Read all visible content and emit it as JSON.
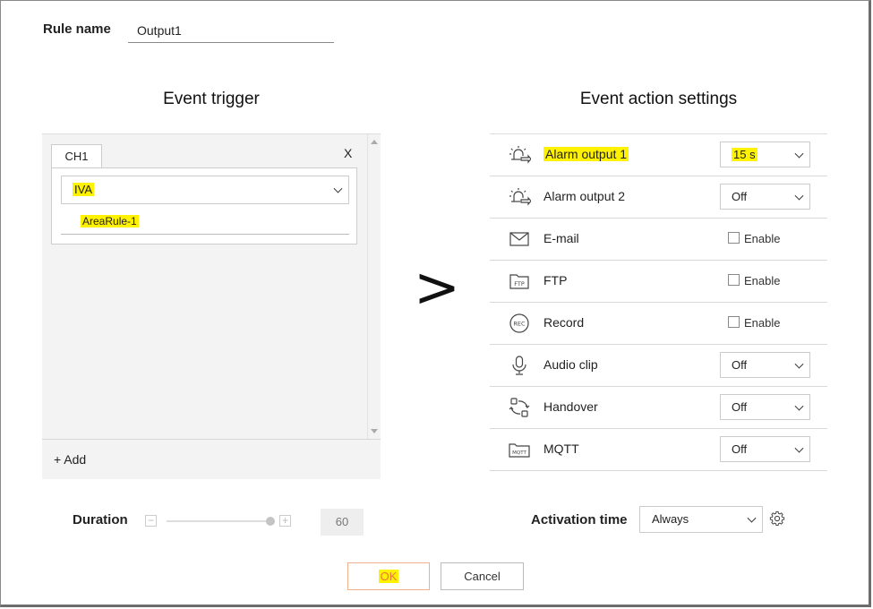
{
  "rule": {
    "label": "Rule name",
    "value": "Output1"
  },
  "event_trigger": {
    "title": "Event trigger",
    "tab_label": "CH1",
    "close_label": "X",
    "event_type": "IVA",
    "rule_item": "AreaRule-1",
    "add_label": "+ Add"
  },
  "separator": ">",
  "event_action": {
    "title": "Event action settings",
    "enable_label": "Enable",
    "actions": [
      {
        "label": "Alarm output 1",
        "value": "15 s",
        "icon": "alarm-output-icon"
      },
      {
        "label": "Alarm output 2",
        "value": "Off",
        "icon": "alarm-output-icon"
      },
      {
        "label": "E-mail",
        "icon": "email-icon"
      },
      {
        "label": "FTP",
        "icon": "ftp-icon",
        "icon_text": "FTP"
      },
      {
        "label": "Record",
        "icon": "record-icon",
        "icon_text": "REC"
      },
      {
        "label": "Audio clip",
        "value": "Off",
        "icon": "microphone-icon"
      },
      {
        "label": "Handover",
        "value": "Off",
        "icon": "handover-icon"
      },
      {
        "label": "MQTT",
        "value": "Off",
        "icon": "mqtt-icon",
        "icon_text": "MQTT"
      }
    ]
  },
  "duration": {
    "label": "Duration",
    "value": "60",
    "minus": "−",
    "plus": "+"
  },
  "activation": {
    "label": "Activation time",
    "value": "Always"
  },
  "buttons": {
    "ok": "OK",
    "cancel": "Cancel"
  },
  "colors": {
    "highlight": "#fff200",
    "ok_border": "#f0b08f"
  }
}
